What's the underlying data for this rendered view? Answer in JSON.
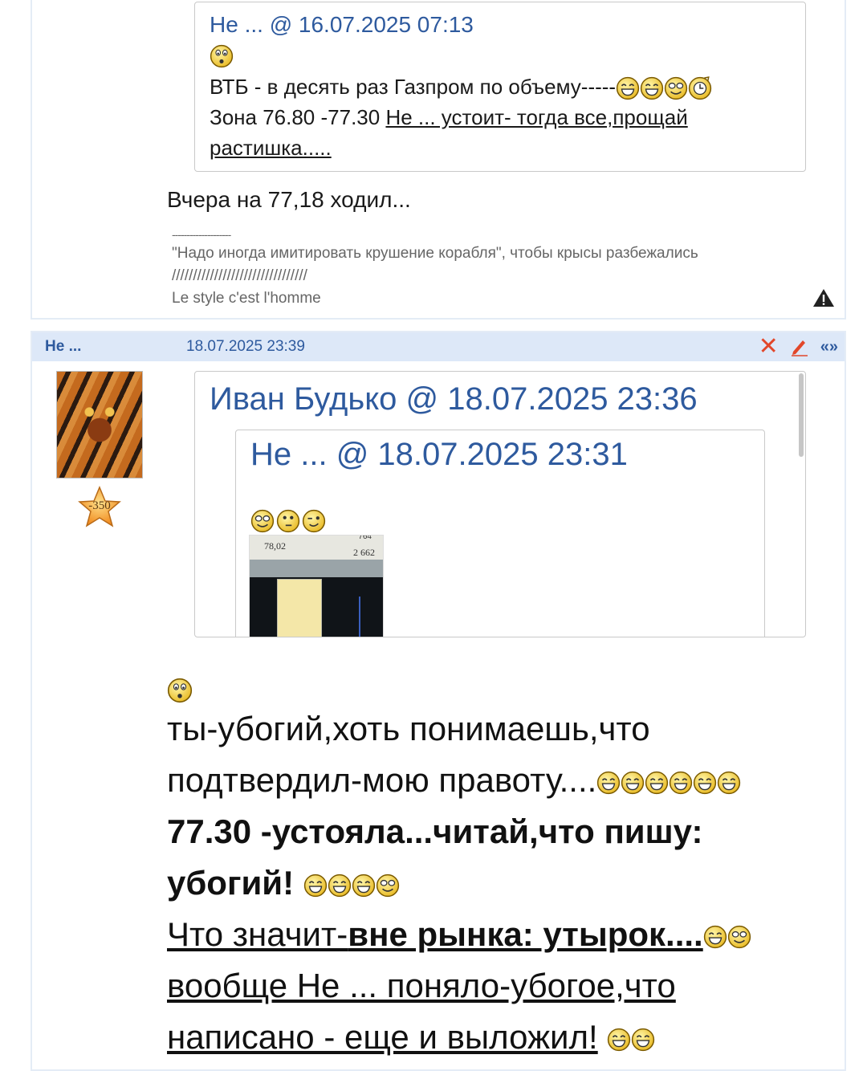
{
  "post1": {
    "quote": {
      "header": "Не ... @ 16.07.2025 07:13",
      "line1": "ВТБ - в десять раз Газпром по объему-----",
      "line2_plain": "Зона 76.80 -77.30 ",
      "line2_link": "Не ... устоит- тогда все,прощай",
      "line3_link": "растишка....."
    },
    "reply": "Вчера на 77,18 ходил...",
    "signature": {
      "divider": "--------------------",
      "quote": "\"Надо иногда имитировать крушение корабля\", чтобы крысы разбежались",
      "slashes": "////////////////////////////////",
      "motto": "Le style c'est l'homme"
    },
    "report_icon": "warning-triangle-icon"
  },
  "post2": {
    "author": "Не ...",
    "date": "18.07.2025 23:39",
    "tools": {
      "delete": "delete-x-icon",
      "edit": "pencil-icon",
      "quote_label": "«»"
    },
    "rank_value": "-350",
    "quote_outer": {
      "header": "Иван Будько @ 18.07.2025 23:36"
    },
    "quote_inner": {
      "header": "Не ... @ 18.07.2025 23:31",
      "image": {
        "price": "78,02",
        "volume": "2 662",
        "top_number": "764"
      }
    },
    "reply": {
      "line1": "ты-убогий,хоть понимаешь,что",
      "line2": "подтвердил-мою правоту....",
      "line3": "77.30 -устояла...читай,что пишу:",
      "line4": "убогий!",
      "line5_plain": "Что значит-",
      "line5_bold": "вне рынка: утырок....",
      "line6": "вообще Не ... поняло-убогое,что",
      "line7": "написано - еще и выложил!"
    }
  },
  "colors": {
    "link_blue": "#2e5a9e",
    "header_bar": "#dde8f8",
    "border": "#e4ecf6",
    "smiley_yellow": "#f2d33a",
    "delete_red": "#e2472a"
  }
}
